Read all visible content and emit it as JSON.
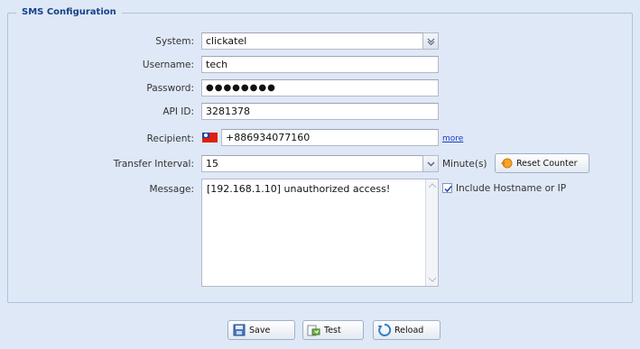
{
  "fieldset": {
    "legend": "SMS Configuration"
  },
  "fields": {
    "system": {
      "label": "System:",
      "value": "clickatel"
    },
    "username": {
      "label": "Username:",
      "value": "tech"
    },
    "password": {
      "label": "Password:",
      "value": "●●●●●●●●"
    },
    "api_id": {
      "label": "API ID:",
      "value": "3281378"
    },
    "recipient": {
      "label": "Recipient:",
      "value": "+886934077160",
      "more_link": "more"
    },
    "transfer_interval": {
      "label": "Transfer Interval:",
      "value": "15",
      "unit": "Minute(s)"
    },
    "message": {
      "label": "Message:",
      "value": "[192.168.1.10] unauthorized access!",
      "include_label": "Include Hostname or IP",
      "include_checked": true
    }
  },
  "buttons": {
    "reset_counter": "Reset Counter",
    "save": "Save",
    "test": "Test",
    "reload": "Reload"
  }
}
